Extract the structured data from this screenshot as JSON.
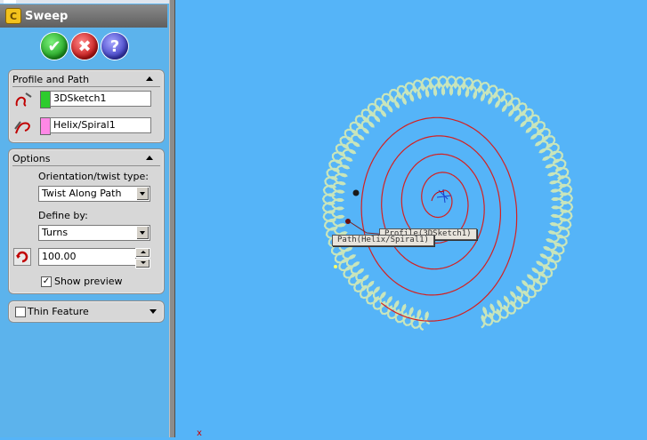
{
  "property_manager": {
    "title": "Sweep",
    "buttons": {
      "ok": "✔",
      "cancel": "✖",
      "help": "?"
    },
    "profile_and_path": {
      "header": "Profile and Path",
      "profile": {
        "value": "3DSketch1",
        "color": "#2ecc2e"
      },
      "path": {
        "value": "Helix/Spiral1",
        "color": "#ff88e6"
      }
    },
    "options": {
      "header": "Options",
      "orientation_label": "Orientation/twist type:",
      "orientation_value": "Twist Along Path",
      "define_by_label": "Define by:",
      "define_by_value": "Turns",
      "turns_value": "100.00",
      "show_preview_label": "Show preview",
      "show_preview_checked": true
    },
    "thin_feature": {
      "label": "Thin Feature",
      "checked": false
    }
  },
  "viewport": {
    "callout_profile": "Profile(3DSketch1)",
    "callout_path": "Path(Helix/Spiral1)",
    "origin_marker": "x",
    "background": "#55b4f8",
    "spiral_color": "#d42020",
    "coil_color": "#cfe8b8"
  }
}
